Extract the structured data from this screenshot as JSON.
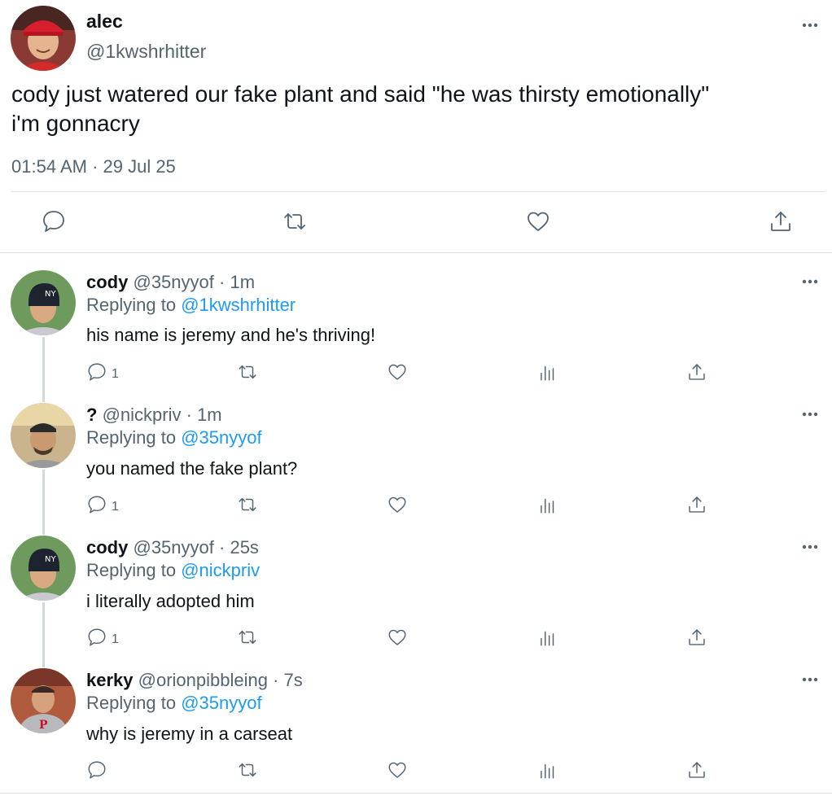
{
  "main_tweet": {
    "display_name": "alec",
    "handle": "@1kwshrhitter",
    "text_line1": "cody just watered our fake plant and said \"he was thirsty emotionally\"",
    "text_line2": "i'm gonnacry",
    "timestamp": "01:54 AM · 29 Jul 25",
    "actions": [
      "reply-icon",
      "retweet-icon",
      "like-icon",
      "share-icon"
    ]
  },
  "replies": [
    {
      "display_name": "cody",
      "handle": "@35nyyof",
      "separator": "·",
      "time": "1m",
      "replying_prefix": "Replying to",
      "replying_to": "@1kwshrhitter",
      "text": "his name is jeremy and he's thriving!",
      "reply_count": "1"
    },
    {
      "display_name": "?",
      "handle": "@nickpriv",
      "separator": "·",
      "time": "1m",
      "replying_prefix": "Replying to",
      "replying_to": "@35nyyof",
      "text": "you named the fake plant?",
      "reply_count": "1"
    },
    {
      "display_name": "cody",
      "handle": "@35nyyof",
      "separator": "·",
      "time": "25s",
      "replying_prefix": "Replying to",
      "replying_to": "@nickpriv",
      "text": "i literally adopted him",
      "reply_count": "1"
    },
    {
      "display_name": "kerky",
      "handle": "@orionpibbleing",
      "separator": "·",
      "time": "7s",
      "replying_prefix": "Replying to",
      "replying_to": "@35nyyof",
      "text": "why is jeremy in a carseat",
      "reply_count": ""
    }
  ],
  "colors": {
    "link": "#1d9bf0",
    "secondary_text": "#536471",
    "primary_text": "#0f1419",
    "divider": "#dfe3e6"
  }
}
